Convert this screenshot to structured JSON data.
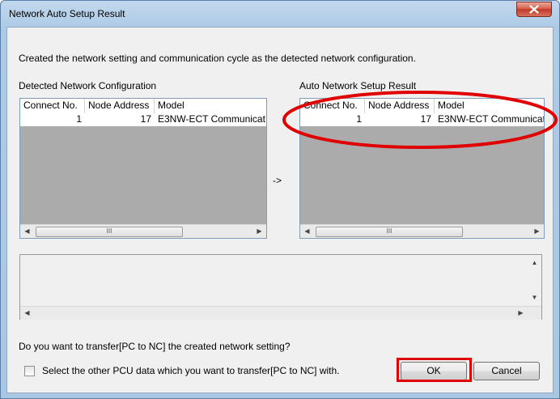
{
  "window": {
    "title": "Network Auto Setup Result"
  },
  "message": "Created the network setting and communication cycle as the detected network configuration.",
  "detected": {
    "label": "Detected Network Configuration",
    "columns": [
      "Connect No.",
      "Node Address",
      "Model"
    ],
    "rows": [
      [
        "1",
        "17",
        "E3NW-ECT Communicat"
      ]
    ]
  },
  "arrow_label": "->",
  "result": {
    "label": "Auto Network Setup Result",
    "columns": [
      "Connect No.",
      "Node Address",
      "Model"
    ],
    "rows": [
      [
        "1",
        "17",
        "E3NW-ECT Communicat"
      ]
    ]
  },
  "question": "Do you want to transfer[PC to NC] the created network setting?",
  "checkbox": {
    "label": "Select the other PCU data which you want to transfer[PC to NC] with.",
    "checked": false
  },
  "buttons": {
    "ok": "OK",
    "cancel": "Cancel"
  },
  "scroll_glyphs": {
    "left": "◀",
    "right": "▶",
    "up": "▲",
    "down": "▼",
    "grip": "III"
  },
  "colors": {
    "highlight": "#e00000",
    "list_background": "#ababab"
  }
}
